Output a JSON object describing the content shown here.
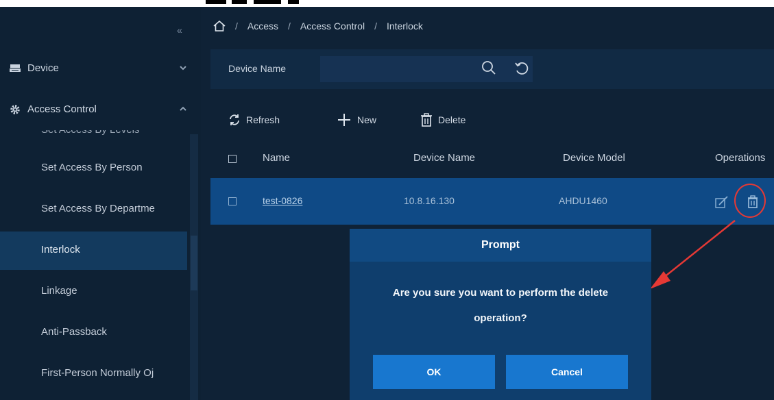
{
  "sidebar": {
    "collapse_icon": "double-chevron-left-icon",
    "menus": [
      {
        "label": "Device",
        "icon": "device-icon",
        "chevron": "chevron-down-icon"
      },
      {
        "label": "Access Control",
        "icon": "gear-icon",
        "chevron": "chevron-up-icon"
      }
    ],
    "partial_item": "Set Access By Levels",
    "items": [
      {
        "label": "Set Access By Person"
      },
      {
        "label": "Set Access By Departme"
      },
      {
        "label": "Interlock"
      },
      {
        "label": "Linkage"
      },
      {
        "label": "Anti-Passback"
      },
      {
        "label": "First-Person Normally Oj"
      }
    ]
  },
  "breadcrumb": {
    "home_icon": "home-icon",
    "items": [
      "Access",
      "Access Control",
      "Interlock"
    ],
    "separator": "/"
  },
  "filter": {
    "label": "Device Name",
    "input_value": "",
    "search_icon": "search-icon",
    "reset_icon": "reset-icon"
  },
  "toolbar": {
    "refresh": "Refresh",
    "new": "New",
    "delete": "Delete"
  },
  "table": {
    "columns": [
      "Name",
      "Device Name",
      "Device Model",
      "Operations"
    ],
    "rows": [
      {
        "name": "test-0826",
        "device_name": "10.8.16.130",
        "device_model": "AHDU1460"
      }
    ]
  },
  "dialog": {
    "title": "Prompt",
    "message_line1": "Are you sure you want to perform the delete",
    "message_line2": "operation?",
    "ok": "OK",
    "cancel": "Cancel"
  },
  "colors": {
    "sidebar_bg": "#0e2134",
    "main_bg": "#0f2236",
    "selected_row": "#0f4a86",
    "dialog_bg": "#0f3e6d",
    "button_blue": "#1877cf",
    "annotation_red": "#e53935"
  }
}
